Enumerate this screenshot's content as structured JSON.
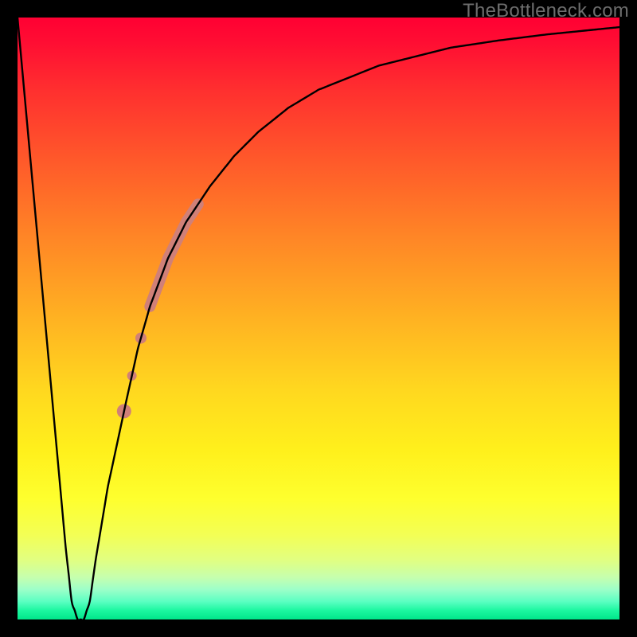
{
  "watermark": "TheBottleneck.com",
  "chart_data": {
    "type": "line",
    "title": "",
    "xlabel": "",
    "ylabel": "",
    "xlim": [
      0,
      100
    ],
    "ylim": [
      0,
      100
    ],
    "grid": false,
    "legend": false,
    "background_gradient": {
      "direction": "vertical",
      "stops": [
        {
          "pct": 0,
          "color": "#ff0033"
        },
        {
          "pct": 50,
          "color": "#ffb222"
        },
        {
          "pct": 80,
          "color": "#feff2e"
        },
        {
          "pct": 100,
          "color": "#00e68a"
        }
      ]
    },
    "series": [
      {
        "name": "bottleneck-curve",
        "color": "#000000",
        "stroke_width": 2,
        "x": [
          0,
          2,
          4,
          6,
          8,
          9,
          10,
          11,
          12,
          13,
          15,
          18,
          20,
          22,
          25,
          28,
          32,
          36,
          40,
          45,
          50,
          55,
          60,
          66,
          72,
          80,
          88,
          94,
          100
        ],
        "y": [
          100,
          78,
          56,
          34,
          12,
          3,
          0,
          0,
          3,
          10,
          22,
          36,
          45,
          52,
          60,
          66,
          72,
          77,
          81,
          85,
          88,
          90,
          92,
          93.5,
          95,
          96.2,
          97.2,
          97.8,
          98.4
        ]
      }
    ],
    "highlight_segment": {
      "color": "#d08078",
      "cap_radius": 8,
      "stroke_width": 14,
      "along_series": "bottleneck-curve",
      "x_start": 22,
      "x_end": 30,
      "extra_dots": [
        {
          "x": 20.5,
          "r": 7
        },
        {
          "x": 19.0,
          "r": 6
        },
        {
          "x": 17.7,
          "r": 9
        }
      ]
    }
  }
}
